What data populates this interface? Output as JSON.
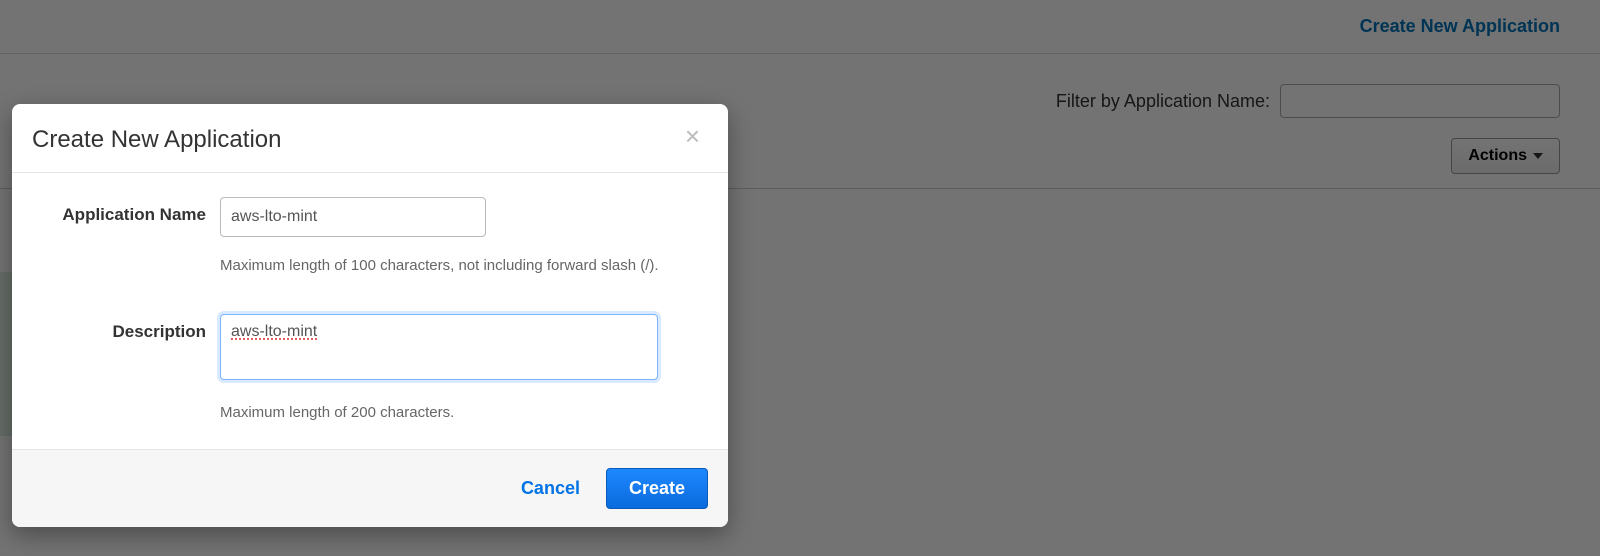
{
  "topbar": {
    "create_link": "Create New Application"
  },
  "filter": {
    "label": "Filter by Application Name:",
    "value": ""
  },
  "actions": {
    "label": "Actions"
  },
  "modal": {
    "title": "Create New Application",
    "fields": {
      "application_name": {
        "label": "Application Name",
        "value": "aws-lto-mint",
        "help": "Maximum length of 100 characters, not including forward slash (/)."
      },
      "description": {
        "label": "Description",
        "value": "aws-lto-mint",
        "help": "Maximum length of 200 characters."
      }
    },
    "buttons": {
      "cancel": "Cancel",
      "create": "Create"
    }
  }
}
